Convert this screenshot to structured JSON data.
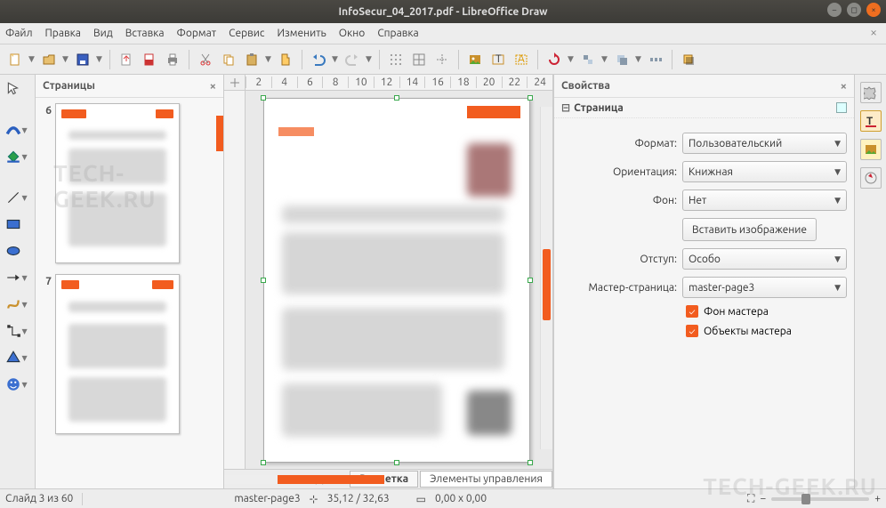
{
  "window": {
    "title": "InfoSecur_04_2017.pdf - LibreOffice Draw"
  },
  "menu": {
    "items": [
      "Файл",
      "Правка",
      "Вид",
      "Вставка",
      "Формат",
      "Сервис",
      "Изменить",
      "Окно",
      "Справка"
    ]
  },
  "pages_panel": {
    "title": "Страницы",
    "thumbs": [
      {
        "num": "6"
      },
      {
        "num": "7"
      }
    ]
  },
  "ruler": {
    "ticks": [
      "2",
      "4",
      "6",
      "8",
      "10",
      "12",
      "14",
      "16",
      "18",
      "20",
      "22",
      "24"
    ]
  },
  "tabs": {
    "layout": "Разметка",
    "controls": "Элементы управления"
  },
  "properties": {
    "title": "Свойства",
    "section": "Страница",
    "format_label": "Формат:",
    "format_value": "Пользовательский",
    "orient_label": "Ориентация:",
    "orient_value": "Книжная",
    "bg_label": "Фон:",
    "bg_value": "Нет",
    "insert_image": "Вставить изображение",
    "margin_label": "Отступ:",
    "margin_value": "Особо",
    "master_label": "Мастер-страница:",
    "master_value": "master-page3",
    "check_bg": "Фон мастера",
    "check_obj": "Объекты мастера"
  },
  "status": {
    "slide": "Слайд 3 из 60",
    "master": "master-page3",
    "pos": "35,12 / 32,63",
    "size": "0,00 x 0,00"
  },
  "watermark": "TECH-GEEK.RU"
}
